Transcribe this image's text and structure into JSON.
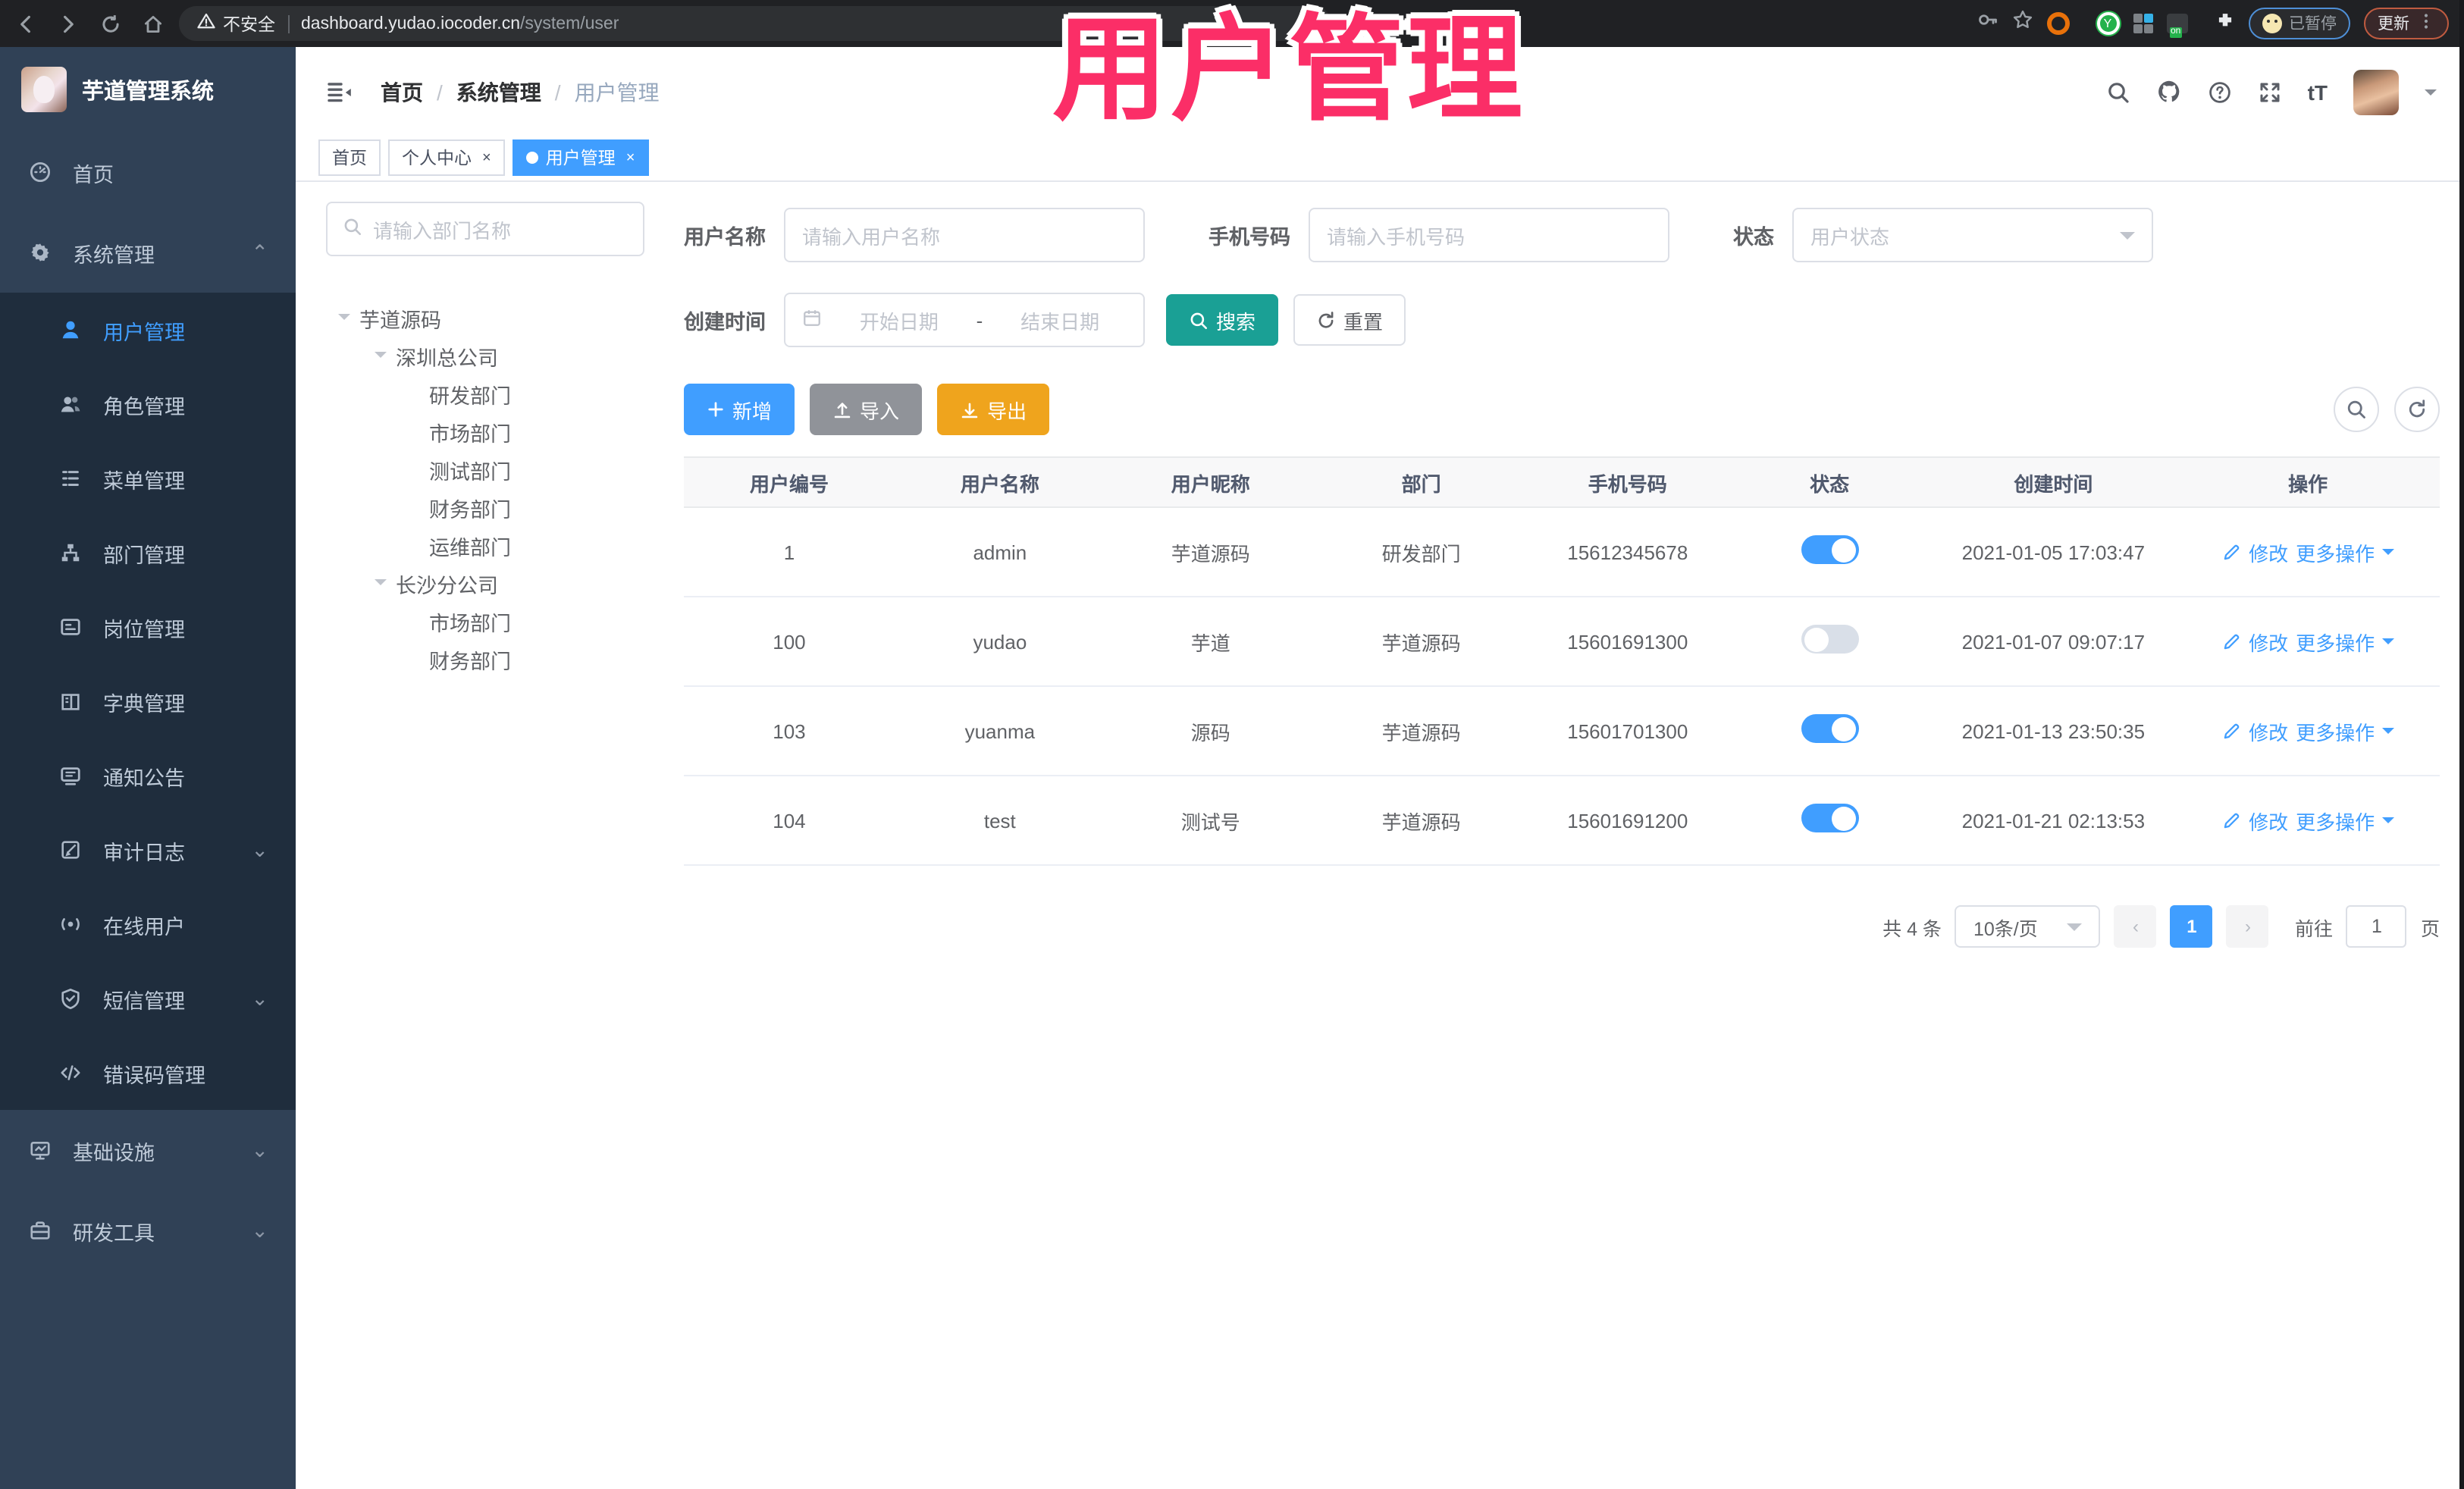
{
  "browser": {
    "security_label": "不安全",
    "url_host": "dashboard.yudao.iocoder.cn",
    "url_path": "/system/user",
    "extension_on_badge": "on",
    "paused_badge": "已暂停",
    "update_button": "更新"
  },
  "overlay": {
    "title": "用户管理"
  },
  "sidebar": {
    "app_title": "芋道管理系统",
    "home": "首页",
    "system": "系统管理",
    "infra": "基础设施",
    "devtools": "研发工具",
    "submenu": [
      "用户管理",
      "角色管理",
      "菜单管理",
      "部门管理",
      "岗位管理",
      "字典管理",
      "通知公告",
      "审计日志",
      "在线用户",
      "短信管理",
      "错误码管理"
    ]
  },
  "header": {
    "breadcrumb": [
      "首页",
      "系统管理",
      "用户管理"
    ],
    "font_size_icon": "tT"
  },
  "tabs": [
    {
      "label": "首页"
    },
    {
      "label": "个人中心",
      "close": "×"
    },
    {
      "label": "用户管理",
      "close": "×"
    }
  ],
  "dept": {
    "search_placeholder": "请输入部门名称",
    "nodes": [
      "芋道源码",
      "深圳总公司",
      "研发部门",
      "市场部门",
      "测试部门",
      "财务部门",
      "运维部门",
      "长沙分公司",
      "市场部门",
      "财务部门"
    ]
  },
  "filters": {
    "username_label": "用户名称",
    "username_placeholder": "请输入用户名称",
    "mobile_label": "手机号码",
    "mobile_placeholder": "请输入手机号码",
    "status_label": "状态",
    "status_placeholder": "用户状态",
    "date_label": "创建时间",
    "date_start": "开始日期",
    "date_separator": "-",
    "date_end": "结束日期",
    "search_button": "搜索",
    "reset_button": "重置"
  },
  "toolbar": {
    "add": "新增",
    "import": "导入",
    "export": "导出"
  },
  "table": {
    "columns": [
      "用户编号",
      "用户名称",
      "用户昵称",
      "部门",
      "手机号码",
      "状态",
      "创建时间",
      "操作"
    ],
    "ops": {
      "edit": "修改",
      "more": "更多操作"
    },
    "rows": [
      {
        "id": "1",
        "username": "admin",
        "nickname": "芋道源码",
        "dept": "研发部门",
        "mobile": "15612345678",
        "status": "on",
        "created": "2021-01-05 17:03:47"
      },
      {
        "id": "100",
        "username": "yudao",
        "nickname": "芋道",
        "dept": "芋道源码",
        "mobile": "15601691300",
        "status": "off",
        "created": "2021-01-07 09:07:17"
      },
      {
        "id": "103",
        "username": "yuanma",
        "nickname": "源码",
        "dept": "芋道源码",
        "mobile": "15601701300",
        "status": "on",
        "created": "2021-01-13 23:50:35"
      },
      {
        "id": "104",
        "username": "test",
        "nickname": "测试号",
        "dept": "芋道源码",
        "mobile": "15601691200",
        "status": "on",
        "created": "2021-01-21 02:13:53"
      }
    ]
  },
  "pagination": {
    "total": "共 4 条",
    "page_size": "10条/页",
    "prev": "‹",
    "current": "1",
    "next": "›",
    "goto_label": "前往",
    "goto_value": "1",
    "page_suffix": "页"
  },
  "colors": {
    "accent": "#409eff",
    "teal": "#1aa095",
    "warning": "#efa41d",
    "grey": "#909399",
    "pink_overlay": "#fb2e67",
    "sidebar": "#304156",
    "submenu": "#1f2d3d"
  }
}
